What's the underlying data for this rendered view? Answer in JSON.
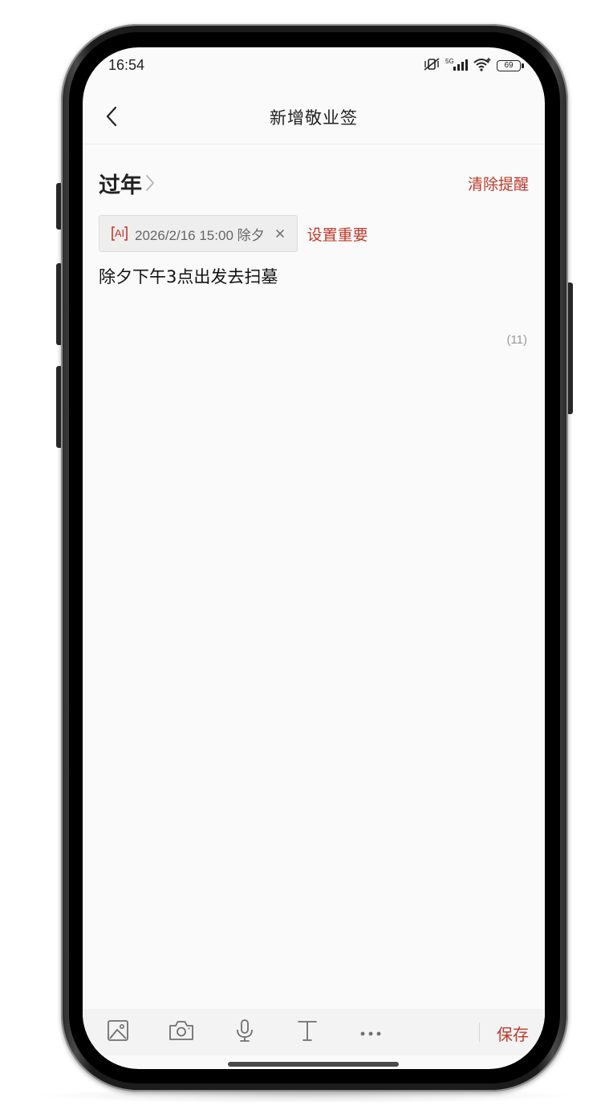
{
  "status_bar": {
    "time": "16:54",
    "network": "5G",
    "battery": "69",
    "icons": [
      "mute-vibrate-icon",
      "cellular-signal-icon",
      "wifi-icon",
      "battery-icon"
    ]
  },
  "header": {
    "title": "新增敬业签",
    "back_icon": "chevron-left-icon"
  },
  "category": {
    "label": "过年",
    "clear_reminder": "清除提醒"
  },
  "reminder": {
    "ai_badge": "AI",
    "text": "2026/2/16 15:00 除夕",
    "set_important": "设置重要"
  },
  "note": {
    "content": "除夕下午3点出发去扫墓",
    "char_count": "(11)"
  },
  "toolbar": {
    "tools": [
      "image-icon",
      "camera-icon",
      "microphone-icon",
      "text-format-icon",
      "more-icon"
    ],
    "save_label": "保存"
  },
  "colors": {
    "accent": "#c0392b",
    "background": "#fafafa",
    "toolbar_bg": "#f3f3f3",
    "text": "#222222"
  }
}
